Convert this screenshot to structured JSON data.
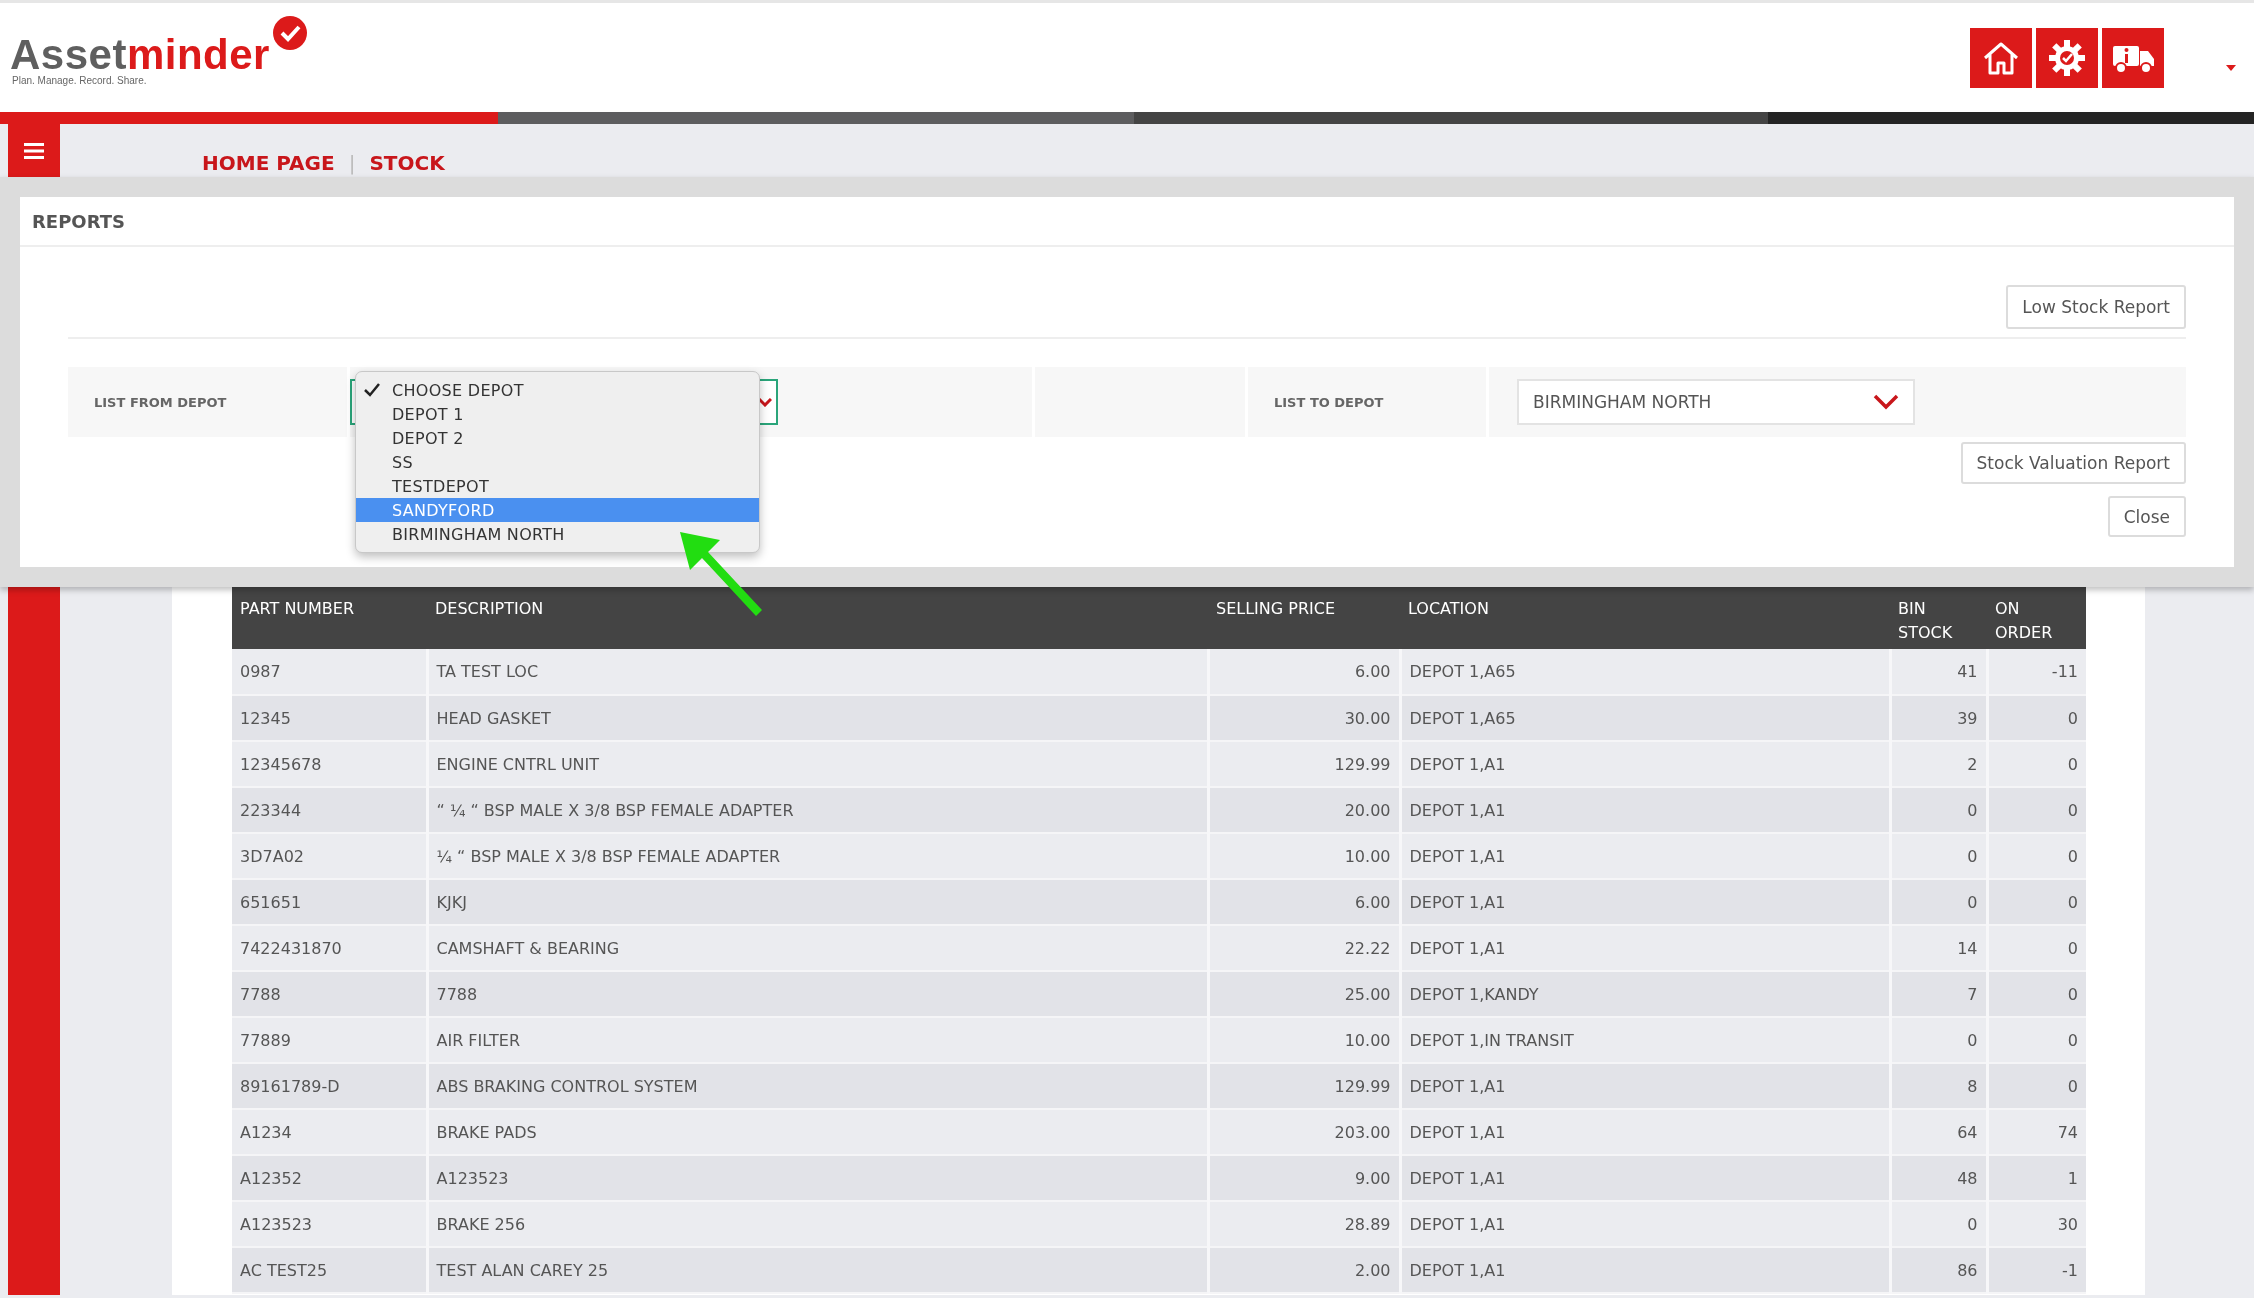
{
  "logo": {
    "prefix": "Asset",
    "suffix": "minder",
    "tagline": "Plan. Manage. Record. Share."
  },
  "breadcrumb": [
    {
      "label": "HOME PAGE"
    },
    {
      "label": "STOCK"
    }
  ],
  "breadcrumb_separator": "|",
  "reports": {
    "title": "REPORTS",
    "low_stock_button": "Low Stock Report",
    "from_label": "LIST FROM DEPOT",
    "from_options": [
      {
        "label": "CHOOSE DEPOT",
        "checked": true,
        "selected": false
      },
      {
        "label": "DEPOT 1",
        "checked": false,
        "selected": false
      },
      {
        "label": "DEPOT 2",
        "checked": false,
        "selected": false
      },
      {
        "label": "SS",
        "checked": false,
        "selected": false
      },
      {
        "label": "TESTDEPOT",
        "checked": false,
        "selected": false
      },
      {
        "label": "SANDYFORD",
        "checked": false,
        "selected": true
      },
      {
        "label": "BIRMINGHAM NORTH",
        "checked": false,
        "selected": false
      }
    ],
    "to_label": "LIST TO DEPOT",
    "to_value": "BIRMINGHAM NORTH",
    "valuation_button": "Stock Valuation Report",
    "close_button": "Close"
  },
  "table": {
    "columns": [
      "PART NUMBER",
      "DESCRIPTION",
      "SELLING PRICE",
      "LOCATION",
      "BIN STOCK",
      "ON ORDER"
    ],
    "rows": [
      [
        "0987",
        "TA TEST LOC",
        "6.00",
        "DEPOT 1,A65",
        "41",
        "-11"
      ],
      [
        "12345",
        "HEAD GASKET",
        "30.00",
        "DEPOT 1,A65",
        "39",
        "0"
      ],
      [
        "12345678",
        "ENGINE CNTRL UNIT",
        "129.99",
        "DEPOT 1,A1",
        "2",
        "0"
      ],
      [
        "223344",
        "“ ¼ “ BSP MALE X 3/8 BSP FEMALE ADAPTER",
        "20.00",
        "DEPOT 1,A1",
        "0",
        "0"
      ],
      [
        "3D7A02",
        "¼ “ BSP MALE X 3/8 BSP FEMALE ADAPTER",
        "10.00",
        "DEPOT 1,A1",
        "0",
        "0"
      ],
      [
        "651651",
        "KJKJ",
        "6.00",
        "DEPOT 1,A1",
        "0",
        "0"
      ],
      [
        "7422431870",
        "CAMSHAFT & BEARING",
        "22.22",
        "DEPOT 1,A1",
        "14",
        "0"
      ],
      [
        "7788",
        "7788",
        "25.00",
        "DEPOT 1,KANDY",
        "7",
        "0"
      ],
      [
        "77889",
        "AIR FILTER",
        "10.00",
        "DEPOT 1,IN TRANSIT",
        "0",
        "0"
      ],
      [
        "89161789-D",
        "ABS BRAKING CONTROL SYSTEM",
        "129.99",
        "DEPOT 1,A1",
        "8",
        "0"
      ],
      [
        "A1234",
        "BRAKE PADS",
        "203.00",
        "DEPOT 1,A1",
        "64",
        "74"
      ],
      [
        "A12352",
        "A123523",
        "9.00",
        "DEPOT 1,A1",
        "48",
        "1"
      ],
      [
        "A123523",
        "BRAKE 256",
        "28.89",
        "DEPOT 1,A1",
        "0",
        "30"
      ],
      [
        "AC TEST25",
        "TEST ALAN CAREY 25",
        "2.00",
        "DEPOT 1,A1",
        "86",
        "-1"
      ]
    ]
  }
}
